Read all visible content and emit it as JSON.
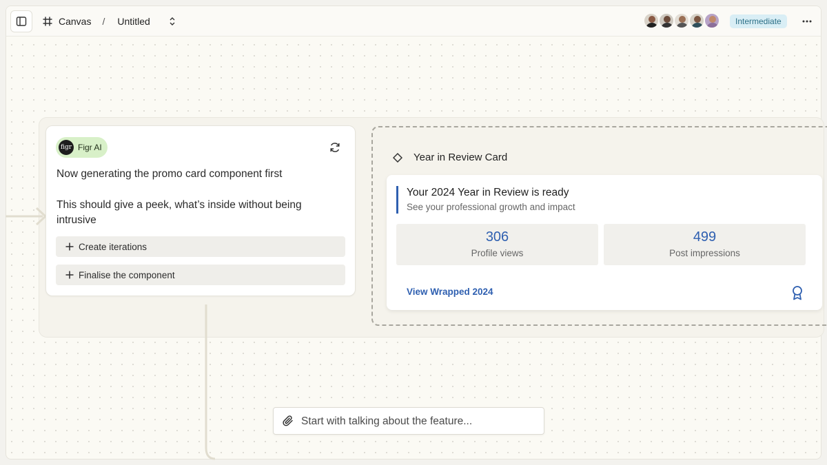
{
  "header": {
    "breadcrumb_root": "Canvas",
    "breadcrumb_separator": "/",
    "document_title": "Untitled",
    "level_badge": "Intermediate",
    "collaborators": [
      {
        "name": "collaborator-1",
        "skin": "#8a5a44",
        "shirt": "#222"
      },
      {
        "name": "collaborator-2",
        "skin": "#6b4b3a",
        "shirt": "#333"
      },
      {
        "name": "collaborator-3",
        "skin": "#9a7055",
        "shirt": "#555"
      },
      {
        "name": "collaborator-4",
        "skin": "#7a5540",
        "shirt": "#2f4f5a"
      },
      {
        "name": "collaborator-5",
        "skin": "#c08a6a",
        "shirt": "#8c6f9a"
      }
    ]
  },
  "chat": {
    "assistant_name": "Figr AI",
    "assistant_logo_text": "figr",
    "message_line_1": "Now generating the promo card component first",
    "message_line_2": "This should give a peek, what’s inside without being intrusive",
    "actions": [
      "Create iterations",
      "Finalise the component"
    ]
  },
  "preview": {
    "frame_title": "Year in Review Card",
    "card": {
      "title": "Your 2024 Year in Review is ready",
      "subtitle": "See your professional growth and impact",
      "stats": [
        {
          "value": "306",
          "label": "Profile views"
        },
        {
          "value": "499",
          "label": "Post impressions"
        }
      ],
      "cta": "View Wrapped 2024"
    }
  },
  "composer": {
    "placeholder": "Start with talking about the feature..."
  },
  "colors": {
    "accent_blue": "#2e5fb0",
    "badge_bg": "#d9eef5",
    "ai_pill_bg": "#d8f0c8",
    "connector": "#e1ddcf"
  }
}
